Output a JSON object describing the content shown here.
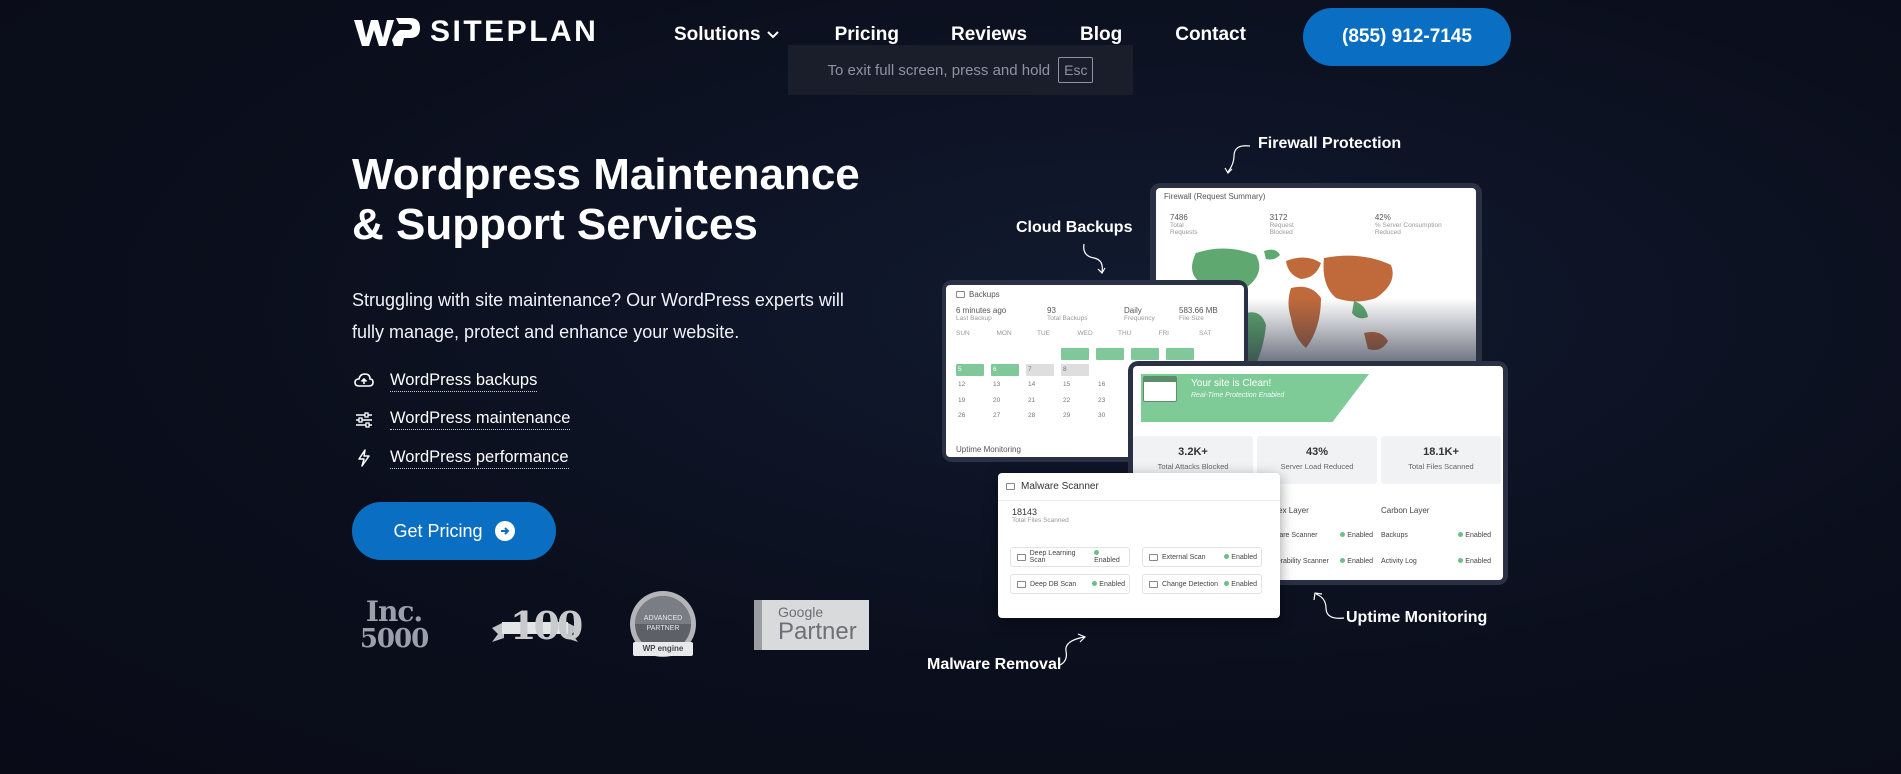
{
  "brand": {
    "name": "SITEPLAN",
    "mark": "WP"
  },
  "nav": {
    "items": [
      {
        "label": "Solutions",
        "has_dropdown": true
      },
      {
        "label": "Pricing"
      },
      {
        "label": "Reviews"
      },
      {
        "label": "Blog"
      },
      {
        "label": "Contact"
      }
    ],
    "phone": "(855) 912-7145"
  },
  "fullscreen_toast": {
    "text": "To exit full screen, press and hold",
    "key": "Esc"
  },
  "hero": {
    "title_line1": "Wordpress Maintenance",
    "title_line2": "& Support Services",
    "description": "Struggling with site maintenance? Our WordPress experts will fully manage, protect and enhance your website.",
    "features": [
      {
        "label": "WordPress backups",
        "icon": "cloud-upload-icon"
      },
      {
        "label": "WordPress maintenance",
        "icon": "sliders-icon"
      },
      {
        "label": "WordPress performance",
        "icon": "lightning-icon"
      }
    ],
    "cta": "Get Pricing",
    "badges": {
      "inc_l1": "Inc.",
      "inc_l2": "5000",
      "hundred": "100",
      "wpe_l1": "ADVANCED",
      "wpe_l2": "PARTNER",
      "wpe_l3": "WP engine",
      "google_l1": "Google",
      "google_l2": "Partner"
    }
  },
  "callouts": {
    "firewall": "Firewall Protection",
    "backups": "Cloud Backups",
    "uptime": "Uptime Monitoring",
    "malware": "Malware Removal"
  },
  "firewall_card": {
    "title": "Firewall (Request Summary)",
    "stats": [
      {
        "value": "7486",
        "label": "Total Requests"
      },
      {
        "value": "3172",
        "label": "Request Blocked"
      },
      {
        "value": "42%",
        "label": "% Server Consumption Reduced"
      }
    ]
  },
  "backups_card": {
    "title": "Backups",
    "stats": [
      {
        "value": "6 minutes ago",
        "label": "Last Backup"
      },
      {
        "value": "93",
        "label": "Total Backups"
      },
      {
        "value": "Daily",
        "label": "Frequency"
      },
      {
        "value": "583.66 MB",
        "label": "File Size"
      }
    ],
    "days": [
      "SUN",
      "MON",
      "TUE",
      "WED",
      "THU",
      "FRI",
      "SAT"
    ],
    "rows": [
      [
        "",
        "",
        "",
        "",
        "",
        "",
        ""
      ],
      [
        "5",
        "6",
        "7",
        "8",
        "",
        "",
        ""
      ],
      [
        "12",
        "13",
        "14",
        "15",
        "16",
        "",
        ""
      ],
      [
        "19",
        "20",
        "21",
        "22",
        "23",
        "",
        ""
      ],
      [
        "26",
        "27",
        "28",
        "29",
        "30",
        "",
        ""
      ]
    ],
    "footer": "Uptime Monitoring"
  },
  "clean_card": {
    "title": "Your site is Clean!",
    "subtitle": "Real-Time Protection Enabled",
    "stats": [
      {
        "value": "3.2K+",
        "label": "Total Attacks Blocked"
      },
      {
        "value": "43%",
        "label": "Server Load Reduced"
      },
      {
        "value": "18.1K+",
        "label": "Total Files Scanned"
      }
    ],
    "layers": [
      "Cortex Layer",
      "Carbon Layer"
    ],
    "layer_rows": [
      {
        "label": "Malware Scanner",
        "status": "Enabled"
      },
      {
        "label": "Vulnerability Scanner",
        "status": "Enabled"
      },
      {
        "label": "Backups",
        "status": "Enabled"
      },
      {
        "label": "Activity Log",
        "status": "Enabled"
      }
    ]
  },
  "malware_card": {
    "title": "Malware Scanner",
    "count": "18143",
    "count_label": "Total Files Scanned",
    "rows": [
      {
        "label": "Deep Learning Scan",
        "status": "Enabled"
      },
      {
        "label": "External Scan",
        "status": "Enabled"
      },
      {
        "label": "Deep DB Scan",
        "status": "Enabled"
      },
      {
        "label": "Change Detection",
        "status": "Enabled"
      }
    ]
  },
  "colors": {
    "accent": "#0a6fc2",
    "background": "#0b0f1d",
    "success": "#7fcb98"
  }
}
